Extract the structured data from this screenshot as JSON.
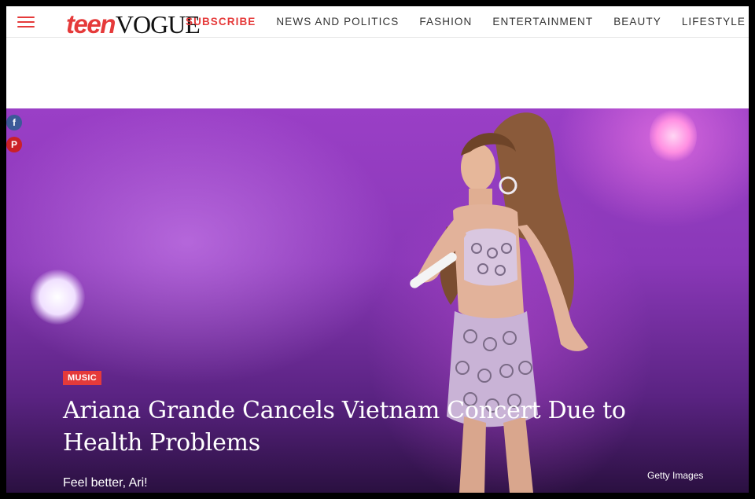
{
  "header": {
    "logo_teen": "teen",
    "logo_vogue": "VOGUE",
    "nav": [
      {
        "label": "SUBSCRIBE"
      },
      {
        "label": "NEWS AND POLITICS"
      },
      {
        "label": "FASHION"
      },
      {
        "label": "ENTERTAINMENT"
      },
      {
        "label": "BEAUTY"
      },
      {
        "label": "LIFESTYLE"
      }
    ]
  },
  "article": {
    "category": "MUSIC",
    "title": "Ariana Grande Cancels Vietnam Concert Due to Health Problems",
    "dek": "Feel better, Ari!",
    "photo_credit": "Getty Images"
  },
  "social": {
    "facebook_glyph": "f",
    "pinterest_glyph": "P"
  },
  "colors": {
    "brand_red": "#e53a3a",
    "hero_purple": "#9a3fc6",
    "facebook": "#3b5998",
    "pinterest": "#cb2027"
  },
  "icons": [
    "hamburger-menu-icon",
    "facebook-icon",
    "pinterest-icon"
  ]
}
